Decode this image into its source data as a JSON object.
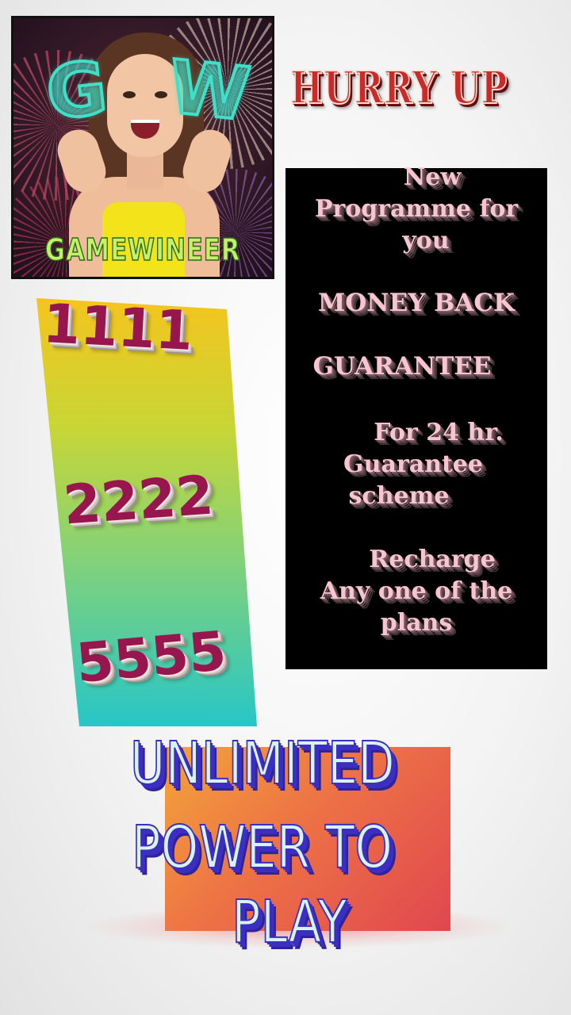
{
  "logo": {
    "letters": [
      "G",
      "W"
    ],
    "brand_name": "GAMEWINEER"
  },
  "headline": "HURRY UP",
  "info_panel": {
    "lines": [
      "New",
      "Programme for",
      "you",
      "MONEY BACK",
      "GUARANTEE",
      "For 24 hr.",
      "Guarantee",
      "scheme",
      "Recharge",
      "Any one of the",
      "plans"
    ]
  },
  "plans": [
    "1111",
    "2222",
    "5555"
  ],
  "banner": {
    "lines": [
      "UNLIMITED",
      "POWER TO",
      "PLAY"
    ]
  },
  "colors": {
    "headline": "#c92b2b",
    "panel_background": "#000000",
    "panel_text": "#f7c5d2",
    "plan_numbers": "#97164e",
    "banner_text": "#d8f3ee",
    "banner_outline": "#3b2ec0"
  }
}
